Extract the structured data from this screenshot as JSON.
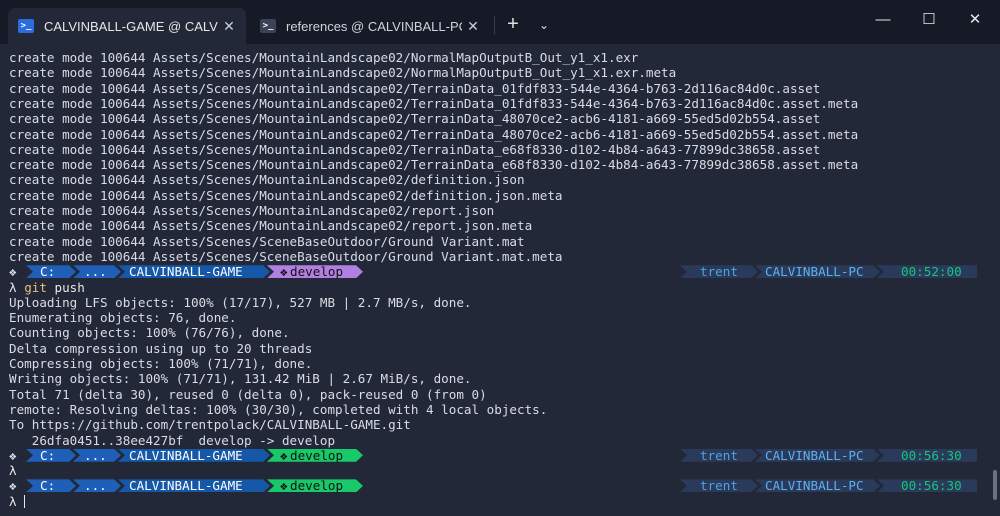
{
  "tabs": [
    {
      "label": "CALVINBALL-GAME @ CALVIN",
      "icon": "terminal-icon",
      "close": "✕"
    },
    {
      "label": "references @ CALVINBALL-PC",
      "icon": "terminal-icon",
      "close": "✕"
    }
  ],
  "new_tab": "+",
  "dropdown": "⌄",
  "window_controls": {
    "minimize": "—",
    "maximize": "☐",
    "close": "✕"
  },
  "output_top": [
    "create mode 100644 Assets/Scenes/MountainLandscape02/NormalMapOutputB_Out_y1_x1.exr",
    "create mode 100644 Assets/Scenes/MountainLandscape02/NormalMapOutputB_Out_y1_x1.exr.meta",
    "create mode 100644 Assets/Scenes/MountainLandscape02/TerrainData_01fdf833-544e-4364-b763-2d116ac84d0c.asset",
    "create mode 100644 Assets/Scenes/MountainLandscape02/TerrainData_01fdf833-544e-4364-b763-2d116ac84d0c.asset.meta",
    "create mode 100644 Assets/Scenes/MountainLandscape02/TerrainData_48070ce2-acb6-4181-a669-55ed5d02b554.asset",
    "create mode 100644 Assets/Scenes/MountainLandscape02/TerrainData_48070ce2-acb6-4181-a669-55ed5d02b554.asset.meta",
    "create mode 100644 Assets/Scenes/MountainLandscape02/TerrainData_e68f8330-d102-4b84-a643-77899dc38658.asset",
    "create mode 100644 Assets/Scenes/MountainLandscape02/TerrainData_e68f8330-d102-4b84-a643-77899dc38658.asset.meta",
    "create mode 100644 Assets/Scenes/MountainLandscape02/definition.json",
    "create mode 100644 Assets/Scenes/MountainLandscape02/definition.json.meta",
    "create mode 100644 Assets/Scenes/MountainLandscape02/report.json",
    "create mode 100644 Assets/Scenes/MountainLandscape02/report.json.meta",
    "create mode 100644 Assets/Scenes/SceneBaseOutdoor/Ground Variant.mat",
    "create mode 100644 Assets/Scenes/SceneBaseOutdoor/Ground Variant.mat.meta"
  ],
  "prompts": [
    {
      "drive": "C:",
      "ellipsis": "...",
      "folder": "CALVINBALL-GAME",
      "branch": "develop",
      "branch_color": "#b07fe0",
      "user": "trent",
      "host": "CALVINBALL-PC",
      "time": "00:52:00"
    },
    {
      "drive": "C:",
      "ellipsis": "...",
      "folder": "CALVINBALL-GAME",
      "branch": "develop",
      "branch_color": "#18c96a",
      "user": "trent",
      "host": "CALVINBALL-PC",
      "time": "00:56:30"
    },
    {
      "drive": "C:",
      "ellipsis": "...",
      "folder": "CALVINBALL-GAME",
      "branch": "develop",
      "branch_color": "#18c96a",
      "user": "trent",
      "host": "CALVINBALL-PC",
      "time": "00:56:30"
    }
  ],
  "prompt_symbol": "λ",
  "prompt_marker": "❖",
  "branch_glyph": "❖",
  "command": "git push",
  "output_push": [
    "Uploading LFS objects: 100% (17/17), 527 MB | 2.7 MB/s, done.",
    "Enumerating objects: 76, done.",
    "Counting objects: 100% (76/76), done.",
    "Delta compression using up to 20 threads",
    "Compressing objects: 100% (71/71), done.",
    "Writing objects: 100% (71/71), 131.42 MiB | 2.67 MiB/s, done.",
    "Total 71 (delta 30), reused 0 (delta 0), pack-reused 0 (from 0)",
    "remote: Resolving deltas: 100% (30/30), completed with 4 local objects.",
    "To https://github.com/trentpolack/CALVINBALL-GAME.git",
    "   26dfa0451..38ee427bf  develop -> develop"
  ],
  "colors": {
    "drive_bg": "#1f5fb8",
    "folder_bg": "#1658a8",
    "folder_fg": "#ffffff",
    "user_bg": "#2a3a5a",
    "user_fg": "#4fa3e0",
    "host_fg": "#5eb0f0",
    "time_fg": "#19c37d",
    "terminal_bg": "#232838"
  }
}
